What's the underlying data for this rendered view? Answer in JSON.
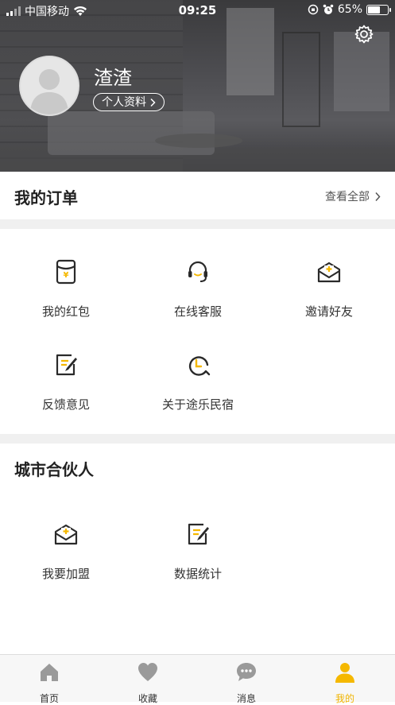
{
  "status_bar": {
    "carrier": "中国移动",
    "time": "09:25",
    "battery_percent": "65%",
    "battery_level": 0.65
  },
  "profile": {
    "username": "渣渣",
    "profile_button": "个人资料"
  },
  "orders": {
    "title": "我的订单",
    "view_all": "查看全部"
  },
  "services": [
    {
      "label": "我的红包",
      "icon": "red-packet-icon"
    },
    {
      "label": "在线客服",
      "icon": "headset-icon"
    },
    {
      "label": "邀请好友",
      "icon": "invite-mail-icon"
    },
    {
      "label": "反馈意见",
      "icon": "feedback-edit-icon"
    },
    {
      "label": "关于途乐民宿",
      "icon": "about-clock-icon"
    }
  ],
  "partner": {
    "title": "城市合伙人",
    "items": [
      {
        "label": "我要加盟",
        "icon": "join-mail-icon"
      },
      {
        "label": "数据统计",
        "icon": "stats-edit-icon"
      }
    ]
  },
  "tabbar": [
    {
      "label": "首页",
      "icon": "home-icon",
      "active": false
    },
    {
      "label": "收藏",
      "icon": "heart-icon",
      "active": false
    },
    {
      "label": "消息",
      "icon": "message-icon",
      "active": false
    },
    {
      "label": "我的",
      "icon": "person-icon",
      "active": true
    }
  ],
  "colors": {
    "accent": "#F5B800",
    "icon_dark": "#2A2A2A",
    "tab_inactive": "#9A9A9A"
  }
}
